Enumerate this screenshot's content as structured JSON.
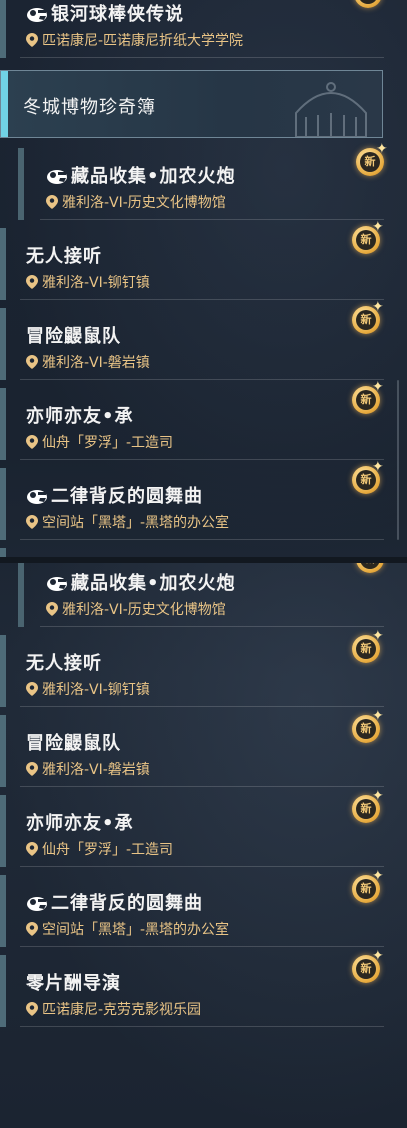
{
  "panel_a": {
    "top_item": {
      "title": "银河球棒侠传说",
      "location": "匹诺康尼-匹诺康尼折纸大学学院",
      "badge": "新"
    },
    "section_header": "冬城博物珍奇簿",
    "items": [
      {
        "title": "藏品收集•加农火炮",
        "location": "雅利洛-VI-历史文化博物馆",
        "badge": "新",
        "hand_icon": true
      },
      {
        "title": "无人接听",
        "location": "雅利洛-VI-铆钉镇",
        "badge": "新"
      },
      {
        "title": "冒险鼹鼠队",
        "location": "雅利洛-VI-磐岩镇",
        "badge": "新"
      },
      {
        "title": "亦师亦友•承",
        "location": "仙舟「罗浮」-工造司",
        "badge": "新"
      },
      {
        "title": "二律背反的圆舞曲",
        "location": "空间站「黑塔」-黑塔的办公室",
        "badge": "新",
        "hand_icon": true
      }
    ]
  },
  "panel_b": {
    "items": [
      {
        "title": "藏品收集•加农火炮",
        "location": "雅利洛-VI-历史文化博物馆",
        "badge": "新",
        "hand_icon": true
      },
      {
        "title": "无人接听",
        "location": "雅利洛-VI-铆钉镇",
        "badge": "新"
      },
      {
        "title": "冒险鼹鼠队",
        "location": "雅利洛-VI-磐岩镇",
        "badge": "新"
      },
      {
        "title": "亦师亦友•承",
        "location": "仙舟「罗浮」-工造司",
        "badge": "新"
      },
      {
        "title": "二律背反的圆舞曲",
        "location": "空间站「黑塔」-黑塔的办公室",
        "badge": "新",
        "hand_icon": true
      },
      {
        "title": "零片酬导演",
        "location": "匹诺康尼-克劳克影视乐园",
        "badge": "新"
      }
    ]
  },
  "colors": {
    "location_text": "#e9c486",
    "accent": "#71d3e6",
    "badge_gold": "#e6a93c"
  }
}
